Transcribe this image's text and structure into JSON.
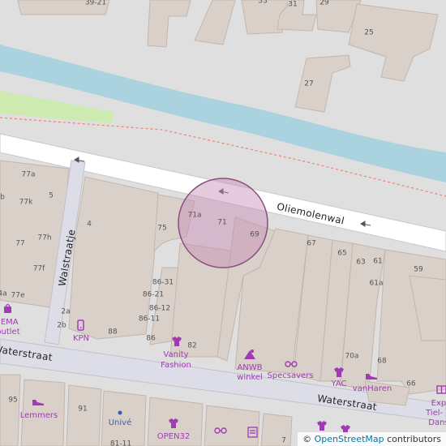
{
  "map": {
    "streets": {
      "oliemolenwal": "Oliemolenwal",
      "walstraatje": "Walstraatje",
      "waterstraat_left": "Waterstraat",
      "waterstraat_right": "Waterstraat"
    },
    "house_numbers": {
      "n39_21": "39-21",
      "n33": "33",
      "n31": "31",
      "n29": "29",
      "n25": "25",
      "n27": "27",
      "n77a": "77a",
      "n77b": "b",
      "n77k": "77k",
      "n5": "5",
      "n4": "4",
      "n75": "75",
      "n71a": "71a",
      "n71": "71",
      "n69": "69",
      "n67": "67",
      "n65": "65",
      "n63": "63",
      "n61": "61",
      "n59": "59",
      "n61a": "61a",
      "n77h": "77h",
      "n77": "77",
      "n77f": "77f",
      "n77e": "77e",
      "n4a": "4a",
      "n86_31": "86-31",
      "n86_21": "86-21",
      "n86_12": "86-12",
      "n86_11": "86-11",
      "n86": "86",
      "n82": "82",
      "n88": "88",
      "n2a": "2a",
      "n2b": "2b",
      "n70a": "70a",
      "n68": "68",
      "n66": "66",
      "n95": "95",
      "n91": "91",
      "n81_11": "81-11",
      "n7": "7"
    },
    "pois": {
      "hema": "HEMA",
      "outlet": "outlet",
      "kpn": "KPN",
      "vanity_fashion_1": "Vanity",
      "vanity_fashion_2": "Fashion",
      "anwb_1": "ANWB",
      "anwb_2": "winkel",
      "specsavers": "Specsavers",
      "yac": "YAC",
      "vanharen": "vanHaren",
      "expe": "Expe",
      "tiel_d": "Tiel- D",
      "dans": "Dans",
      "lemmers": "Lemmers",
      "unive": "Univé",
      "open32": "OPEN32"
    },
    "colors": {
      "background": "#e0dfdf",
      "building": "#d9d0c9",
      "building_stroke": "#c4b6ab",
      "water": "#aad3df",
      "grass": "#cdebb0",
      "road": "#ffffff",
      "pedestrian": "#dddde8",
      "highlight_fill": "#c48bb3",
      "highlight_stroke": "#8a4d7c",
      "poi": "#a13bb3",
      "path_dash": "#f08070"
    }
  },
  "attribution": {
    "copyright": "©",
    "link_text": "OpenStreetMap",
    "suffix": " contributors"
  }
}
